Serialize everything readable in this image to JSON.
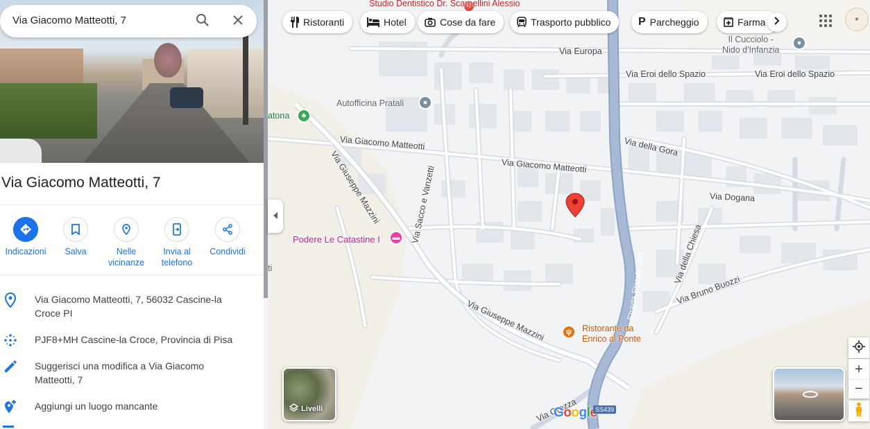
{
  "search": {
    "query": "Via Giacomo Matteotti, 7"
  },
  "place": {
    "title": "Via Giacomo Matteotti, 7"
  },
  "actions": [
    {
      "label": "Indicazioni",
      "icon": "directions-icon"
    },
    {
      "label": "Salva",
      "icon": "bookmark-icon"
    },
    {
      "label": "Nelle vicinanze",
      "icon": "nearby-icon"
    },
    {
      "label": "Invia al telefono",
      "icon": "send-to-phone-icon"
    },
    {
      "label": "Condividi",
      "icon": "share-icon"
    }
  ],
  "info": [
    {
      "text": "Via Giacomo Matteotti, 7, 56032 Cascine-la Croce PI",
      "icon": "location-pin-icon"
    },
    {
      "text": "PJF8+MH Cascine-la Croce, Provincia di Pisa",
      "icon": "plus-code-icon"
    },
    {
      "text": "Suggerisci una modifica a Via Giacomo Matteotti, 7",
      "icon": "pencil-icon"
    },
    {
      "text": "Aggiungi un luogo mancante",
      "icon": "add-place-icon"
    }
  ],
  "chips": [
    {
      "label": "Ristoranti",
      "icon": "restaurant-icon"
    },
    {
      "label": "Hotel",
      "icon": "hotel-icon"
    },
    {
      "label": "Cose da fare",
      "icon": "camera-icon"
    },
    {
      "label": "Trasporto pubblico",
      "icon": "transit-icon"
    },
    {
      "label": "Parcheggio",
      "icon": "parking-icon"
    },
    {
      "label": "Farma",
      "icon": "pharmacy-icon"
    }
  ],
  "map": {
    "places": {
      "dentist": "Studio Dentistico Dr. Scarpellini Alessio",
      "kindergarten_line1": "Il Cucciolo -",
      "kindergarten_line2": "Nido d'Infanzia",
      "autofficina": "Autofficina Pratali",
      "atona": "atona",
      "podere": "Podere Le Catastine I",
      "ristorante_line1": "Ristorante da",
      "ristorante_line2": "Enrico al Ponte",
      "ti": "ti"
    },
    "streets": {
      "europa": "Via Europa",
      "eroi1": "Via Eroi dello Spazio",
      "eroi2": "Via Eroi dello Spazio",
      "matteotti1": "Via Giacomo Matteotti",
      "matteotti2": "Via Giacomo Matteotti",
      "gora": "Via della Gora",
      "dogana": "Via Dogana",
      "mazzini1": "Via Giuseppe Mazzini",
      "mazzini2": "Via Giuseppe Mazzini",
      "sacco": "Via Sacco e Vanzetti",
      "chiesa": "Via della Chiesa",
      "buozzi": "Via Bruno Buozzi",
      "statale": "Strada Statale 439",
      "grezza": "Via Grezza"
    },
    "layers_label": "Livelli",
    "road_shield": "SS439",
    "logo": [
      "G",
      "o",
      "o",
      "g",
      "l",
      "e"
    ]
  },
  "colors": {
    "accent": "#1a73e8",
    "pin": "#ea4335",
    "road_major": "#a8b9d6",
    "poi_gray": "#7b8fa3",
    "poi_green": "#34a853",
    "poi_pink": "#e63ea5",
    "poi_orange": "#e8710a"
  }
}
